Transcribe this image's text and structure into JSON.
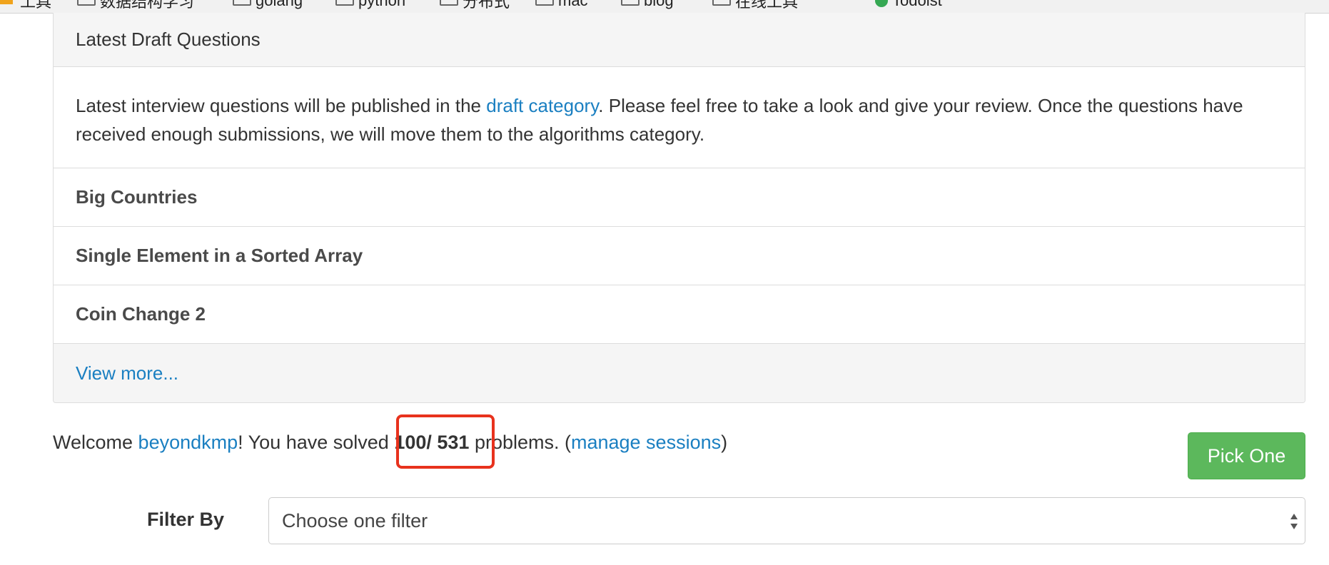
{
  "bookmarks": {
    "items": [
      {
        "label": "工具"
      },
      {
        "label": "数据结构学习"
      },
      {
        "label": "golang"
      },
      {
        "label": "python"
      },
      {
        "label": "分布式"
      },
      {
        "label": "mac"
      },
      {
        "label": "blog"
      },
      {
        "label": "在线工具"
      },
      {
        "label": "Todoist"
      }
    ]
  },
  "panel": {
    "heading": "Latest Draft Questions",
    "intro_before": "Latest interview questions will be published in the ",
    "intro_link": "draft category",
    "intro_after": ". Please feel free to take a look and give your review. Once the questions have received enough submissions, we will move them to the algorithms category.",
    "questions": [
      {
        "title": "Big Countries"
      },
      {
        "title": "Single Element in a Sorted Array"
      },
      {
        "title": "Coin Change 2"
      }
    ],
    "view_more": "View more..."
  },
  "welcome": {
    "prefix": "Welcome ",
    "username": "beyondkmp",
    "middle": "! You have solved ",
    "solved": "100/ 531",
    "suffix": " problems. (",
    "manage_link": "manage sessions",
    "close_paren": ")"
  },
  "actions": {
    "pick_one": "Pick One"
  },
  "filter": {
    "label": "Filter By",
    "selected": "Choose one filter"
  },
  "colors": {
    "link": "#1a7fc1",
    "pick_button": "#5cb85c",
    "highlight": "#e8321d"
  }
}
